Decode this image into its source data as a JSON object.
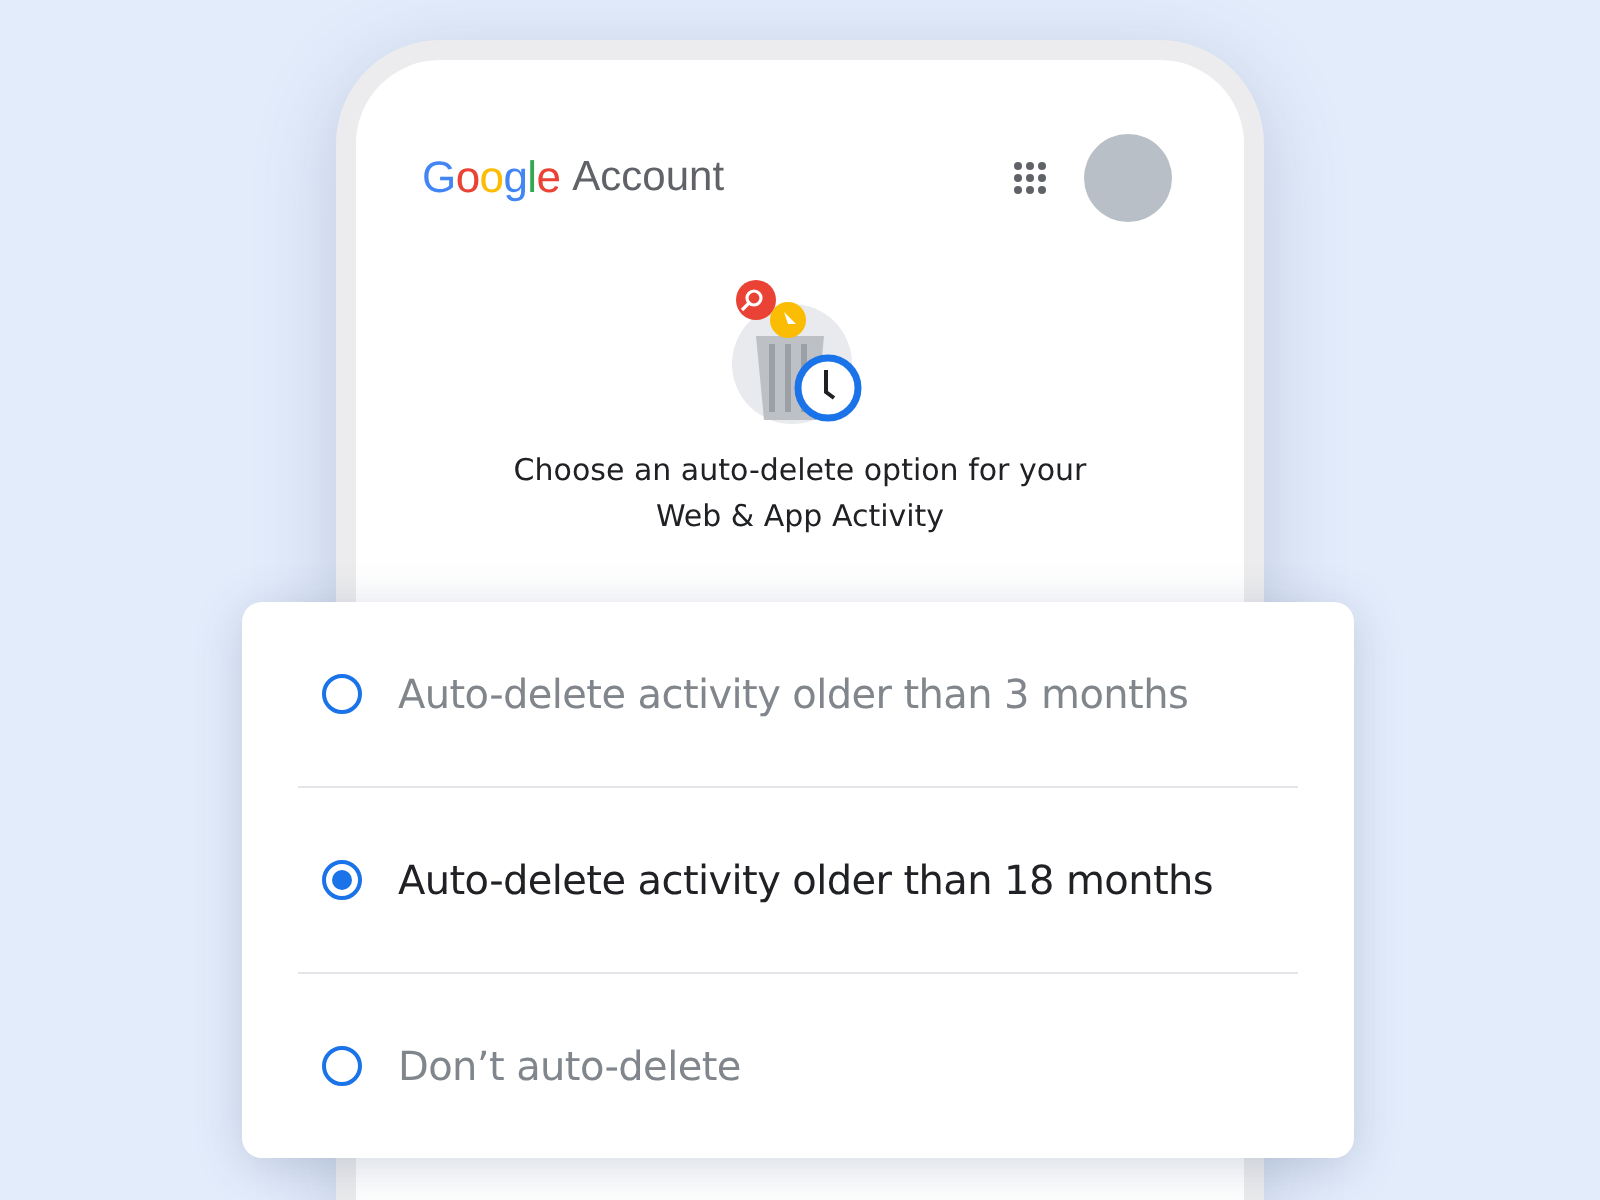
{
  "header": {
    "logo": "Google",
    "title": "Account"
  },
  "prompt": {
    "line_1": "Choose an auto-delete option for your",
    "line_2": "Web & App Activity"
  },
  "options": [
    {
      "label": "Auto-delete activity older than 3 months",
      "selected": false
    },
    {
      "label": "Auto-delete activity older than 18 months",
      "selected": true
    },
    {
      "label": "Don’t auto-delete",
      "selected": false
    }
  ]
}
